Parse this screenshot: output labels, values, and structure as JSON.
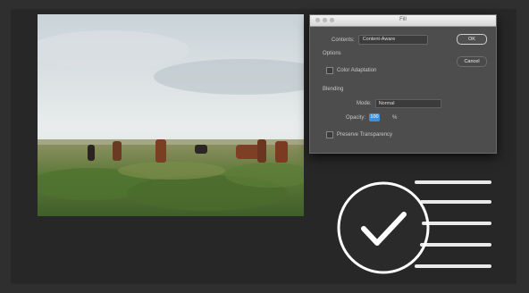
{
  "dialog": {
    "title": "Fill",
    "contents_label": "Contents:",
    "contents_value": "Content-Aware",
    "ok_label": "OK",
    "options_heading": "Options",
    "cancel_label": "Cancel",
    "color_adaptation_label": "Color Adaptation",
    "blending_heading": "Blending",
    "mode_label": "Mode:",
    "mode_value": "Normal",
    "opacity_label": "Opacity:",
    "opacity_value": "100",
    "opacity_unit": "%",
    "preserve_label": "Preserve Transparency"
  },
  "colors": {
    "background": "#2f2f2f",
    "dialog": "#4d4d4d",
    "accent": "#3b8fdc",
    "check": "#ffffff"
  },
  "icons": {
    "success": "checkmark-circle-icon"
  }
}
